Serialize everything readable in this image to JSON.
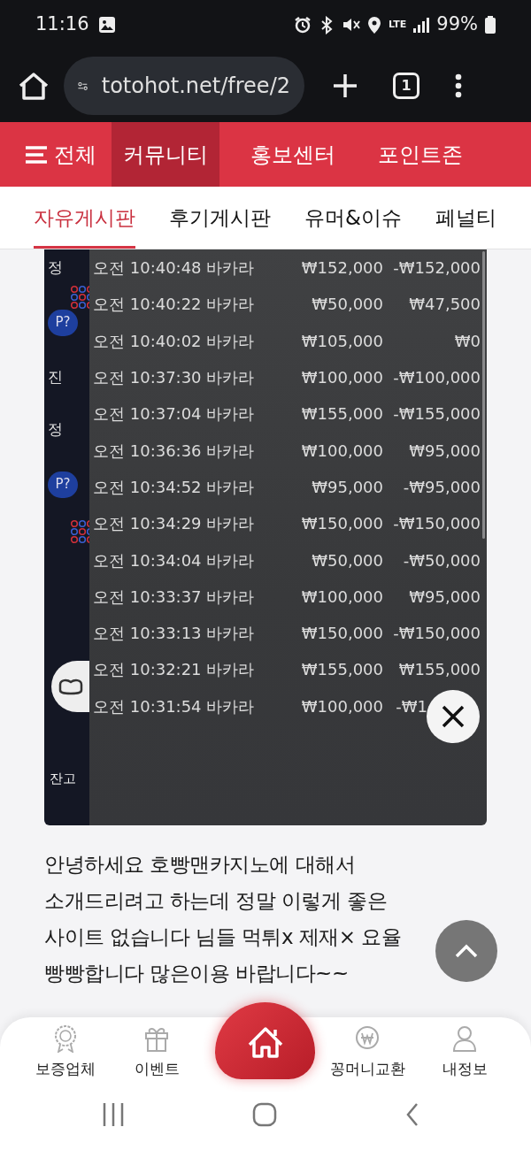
{
  "status_bar": {
    "time": "11:16",
    "network": "LTE",
    "battery": "99%"
  },
  "browser": {
    "url": "totohot.net/free/2",
    "tab_count": "1"
  },
  "main_nav": [
    {
      "label": "전체",
      "kind": "menu",
      "selected": false
    },
    {
      "label": "커뮤니티",
      "kind": "link",
      "selected": true
    },
    {
      "label": "홍보센터",
      "kind": "link",
      "selected": false
    },
    {
      "label": "포인트존",
      "kind": "link",
      "selected": false
    }
  ],
  "sub_nav": [
    {
      "label": "자유게시판",
      "selected": true
    },
    {
      "label": "후기게시판",
      "selected": false
    },
    {
      "label": "유머&이슈",
      "selected": false
    },
    {
      "label": "페널티",
      "selected": false
    }
  ],
  "screenshot": {
    "side_labels": [
      {
        "text": "정",
        "kind": "text"
      },
      {
        "text": "P?",
        "kind": "chip"
      },
      {
        "text": "진",
        "kind": "text"
      },
      {
        "text": "정",
        "kind": "text"
      },
      {
        "text": "P?",
        "kind": "chip"
      }
    ],
    "rows": [
      {
        "time": "오전 10:40:48",
        "game": "바카라",
        "bet": "₩152,000",
        "result": "-₩152,000"
      },
      {
        "time": "오전 10:40:22",
        "game": "바카라",
        "bet": "₩50,000",
        "result": "₩47,500"
      },
      {
        "time": "오전 10:40:02",
        "game": "바카라",
        "bet": "₩105,000",
        "result": "₩0"
      },
      {
        "time": "오전 10:37:30",
        "game": "바카라",
        "bet": "₩100,000",
        "result": "-₩100,000"
      },
      {
        "time": "오전 10:37:04",
        "game": "바카라",
        "bet": "₩155,000",
        "result": "-₩155,000"
      },
      {
        "time": "오전 10:36:36",
        "game": "바카라",
        "bet": "₩100,000",
        "result": "₩95,000"
      },
      {
        "time": "오전 10:34:52",
        "game": "바카라",
        "bet": "₩95,000",
        "result": "-₩95,000"
      },
      {
        "time": "오전 10:34:29",
        "game": "바카라",
        "bet": "₩150,000",
        "result": "-₩150,000"
      },
      {
        "time": "오전 10:34:04",
        "game": "바카라",
        "bet": "₩50,000",
        "result": "-₩50,000"
      },
      {
        "time": "오전 10:33:37",
        "game": "바카라",
        "bet": "₩100,000",
        "result": "₩95,000"
      },
      {
        "time": "오전 10:33:13",
        "game": "바카라",
        "bet": "₩150,000",
        "result": "-₩150,000"
      },
      {
        "time": "오전 10:32:21",
        "game": "바카라",
        "bet": "₩155,000",
        "result": "₩155,000"
      },
      {
        "time": "오전 10:31:54",
        "game": "바카라",
        "bet": "₩100,000",
        "result": "-₩1"
      }
    ],
    "balance_label": "잔고"
  },
  "post": {
    "text": "안녕하세요 호빵맨카지노에 대해서 소개드리려고 하는데 정말 이렇게 좋은 사이트 없습니다 님들 먹튀x 제재× 요율 빵빵합니다 많은이용 바랍니다~~"
  },
  "bottom_nav": [
    {
      "label": "보증업체",
      "kind": "medal"
    },
    {
      "label": "이벤트",
      "kind": "gift"
    },
    {
      "kind": "home"
    },
    {
      "label": "꽁머니교환",
      "kind": "coin"
    },
    {
      "label": "내정보",
      "kind": "person"
    }
  ]
}
